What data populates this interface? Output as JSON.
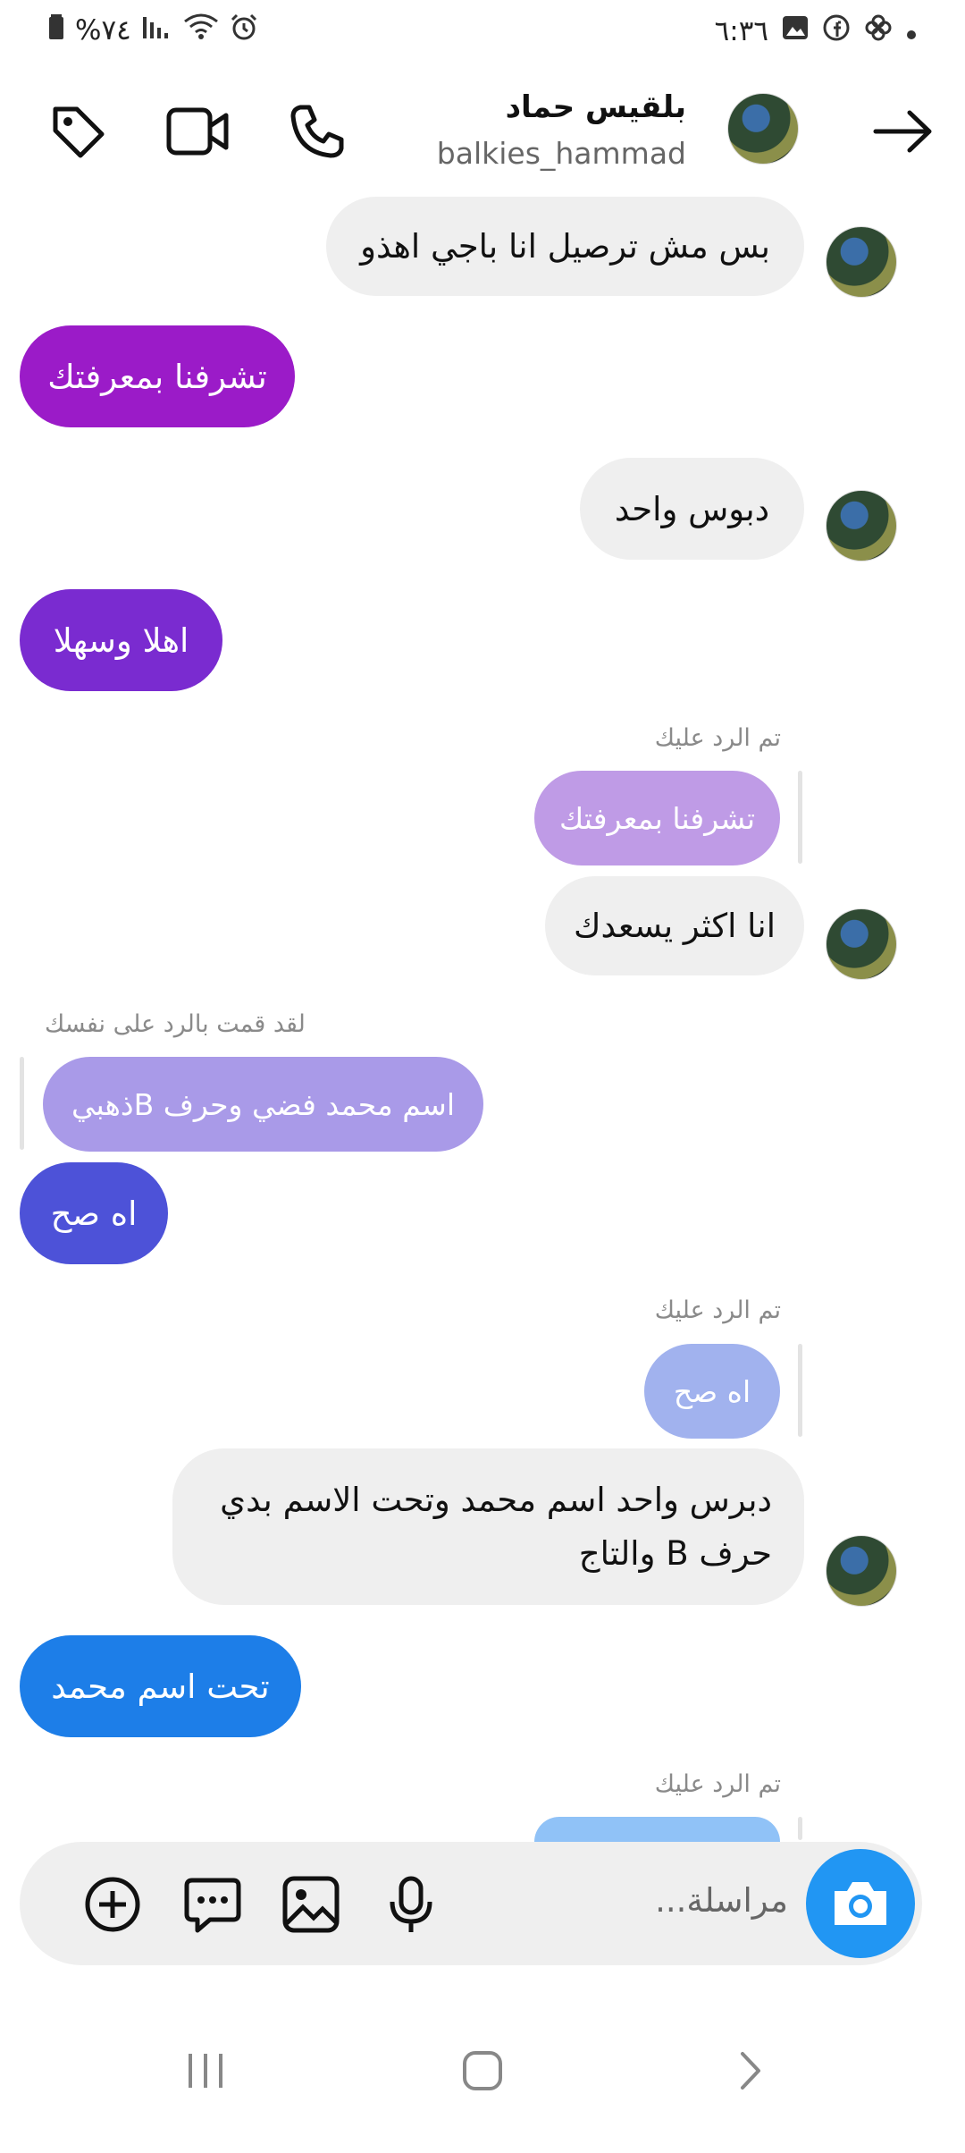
{
  "status_bar": {
    "time": "٦:٣٦",
    "battery": "%٧٤",
    "icons": [
      "battery-icon",
      "signal-icon",
      "wifi-icon",
      "alarm-icon",
      "dot-icon",
      "pinwheel-icon",
      "facebook-icon",
      "gallery-icon"
    ]
  },
  "header": {
    "name": "بلقيس حماد",
    "username": "balkies_hammad",
    "icons": [
      "back-arrow-icon",
      "phone-icon",
      "video-icon",
      "tag-icon"
    ]
  },
  "messages": [
    {
      "side": "in",
      "text": "بس مش ترصيل انا باجي اهذو"
    },
    {
      "side": "out",
      "text": "تشرفنا بمعرفتك",
      "color": "#9b1bc8"
    },
    {
      "side": "in",
      "text": "دبوس واحد"
    },
    {
      "side": "out",
      "text": "اهلا وسهلا",
      "color": "#7a2bd0"
    },
    {
      "side": "in",
      "reply_label": "تم الرد عليك",
      "quote": "تشرفنا بمعرفتك",
      "text": "انا اكثر يسعدك"
    },
    {
      "side": "out",
      "reply_label": "لقد قمت بالرد على نفسك",
      "quote": "اسم محمد فضي وحرف Bذهبي",
      "text": "اه صح",
      "color": "#4d52d8"
    },
    {
      "side": "in",
      "reply_label": "تم الرد عليك",
      "quote": "اه صح",
      "text_line1": "دبرس واحد اسم محمد وتحت الاسم بدي",
      "text_line2": "حرف B  والتاج"
    },
    {
      "side": "out",
      "text": "تحت اسم محمد",
      "color": "#1d7ee8"
    },
    {
      "side": "in",
      "reply_label": "تم الرد عليك"
    }
  ],
  "composer": {
    "placeholder": "مراسلة...",
    "icons": [
      "camera-icon",
      "microphone-icon",
      "image-icon",
      "chat-bubble-icon",
      "add-circle-icon"
    ]
  },
  "nav": {
    "icons": [
      "recent-apps-icon",
      "home-icon",
      "back-icon"
    ]
  }
}
